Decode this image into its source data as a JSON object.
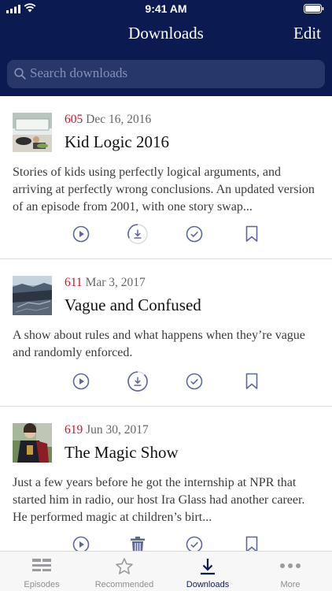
{
  "status_bar": {
    "time": "9:41 AM"
  },
  "nav": {
    "title": "Downloads",
    "edit_label": "Edit"
  },
  "search": {
    "placeholder": "Search downloads"
  },
  "episodes": [
    {
      "number": "605",
      "date": "Dec 16, 2016",
      "title": "Kid Logic 2016",
      "description": "Stories of kids using perfectly logical arguments, and arriving at perfectly wrong conclusions. An updated version of an episode from 2001, with one story swap...",
      "actions": [
        "play-icon",
        "download-progress-icon",
        "check-circle-icon",
        "bookmark-icon"
      ]
    },
    {
      "number": "611",
      "date": "Mar 3, 2017",
      "title": "Vague and Confused",
      "description": "A show about rules and what happens when they’re vague and randomly enforced.",
      "actions": [
        "play-icon",
        "download-progress-icon",
        "check-circle-icon",
        "bookmark-icon"
      ]
    },
    {
      "number": "619",
      "date": "Jun 30, 2017",
      "title": "The Magic Show",
      "description": "Just a few years before he got the internship at NPR that started him in radio, our host Ira Glass had another career. He performed magic at children’s birt...",
      "actions": [
        "play-icon",
        "trash-icon",
        "check-circle-icon",
        "bookmark-icon"
      ]
    }
  ],
  "tabs": [
    {
      "label": "Episodes",
      "icon": "episodes-icon",
      "active": false
    },
    {
      "label": "Recommended",
      "icon": "star-icon",
      "active": false
    },
    {
      "label": "Downloads",
      "icon": "download-icon",
      "active": true
    },
    {
      "label": "More",
      "icon": "more-icon",
      "active": false
    }
  ],
  "colors": {
    "header_bg": "#0c1a52",
    "episode_number": "#d0102a",
    "action_icon": "#5b6699",
    "active_tab": "#0c1a52"
  }
}
